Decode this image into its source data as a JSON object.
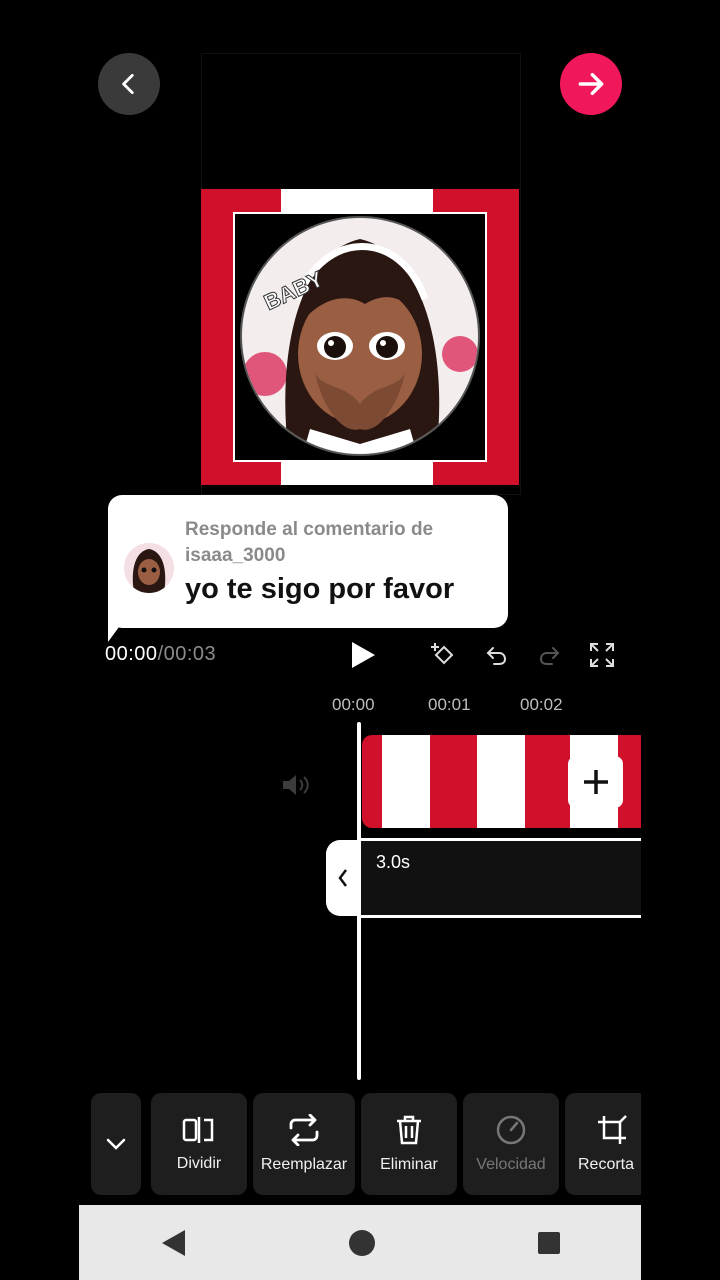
{
  "header": {
    "back_icon": "chevron-left-icon",
    "next_icon": "arrow-right-icon",
    "accent": "#f0185a"
  },
  "comment": {
    "reply_label": "Responde al comentario de isaaa_3000",
    "text": "yo te sigo por favor"
  },
  "player": {
    "current_time": "00:00",
    "separator": "/",
    "total_time": "00:03",
    "play_icon": "play-icon",
    "keyframe_icon": "keyframe-add-icon",
    "undo_icon": "undo-icon",
    "redo_icon": "redo-icon",
    "fullscreen_icon": "fullscreen-icon"
  },
  "timeline": {
    "ruler": [
      "00:00",
      "00:01",
      "00:02"
    ],
    "mute_icon": "volume-icon",
    "add_clip_icon": "plus-icon",
    "track_duration": "3.0s"
  },
  "toolbar": {
    "collapse_icon": "chevron-down-icon",
    "tools": [
      {
        "label": "Dividir",
        "icon": "split-icon",
        "enabled": true
      },
      {
        "label": "Reemplazar",
        "icon": "replace-icon",
        "enabled": true
      },
      {
        "label": "Eliminar",
        "icon": "trash-icon",
        "enabled": true
      },
      {
        "label": "Velocidad",
        "icon": "speed-gauge-icon",
        "enabled": false
      },
      {
        "label": "Recorta",
        "icon": "crop-icon",
        "enabled": true
      }
    ]
  },
  "colors": {
    "stripe_red": "#d1112b",
    "accent": "#f0185a"
  }
}
